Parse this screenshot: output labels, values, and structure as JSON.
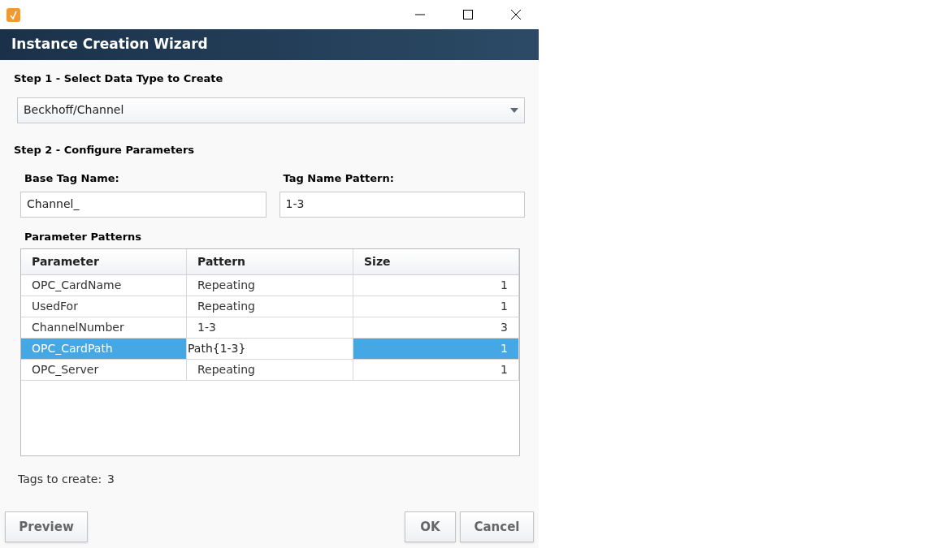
{
  "header": {
    "title": "Instance Creation Wizard"
  },
  "step1": {
    "label": "Step 1 - Select Data Type to Create",
    "dropdown": {
      "value": "Beckhoff/Channel"
    }
  },
  "step2": {
    "label": "Step 2 - Configure Parameters",
    "base_tag_name": {
      "label": "Base Tag Name:",
      "value": "Channel_"
    },
    "tag_name_pattern": {
      "label": "Tag Name Pattern:",
      "value": "1-3"
    }
  },
  "table": {
    "title": "Parameter Patterns",
    "columns": [
      "Parameter",
      "Pattern",
      "Size"
    ],
    "rows": [
      {
        "cells": [
          "OPC_CardName",
          "Repeating",
          "1"
        ],
        "selected": false,
        "editing": false
      },
      {
        "cells": [
          "UsedFor",
          "Repeating",
          "1"
        ],
        "selected": false,
        "editing": false
      },
      {
        "cells": [
          "ChannelNumber",
          "1-3",
          "3"
        ],
        "selected": false,
        "editing": false
      },
      {
        "cells": [
          "OPC_CardPath",
          "Path{1-3}",
          "1"
        ],
        "selected": true,
        "editing": true
      },
      {
        "cells": [
          "OPC_Server",
          "Repeating",
          "1"
        ],
        "selected": false,
        "editing": false
      }
    ]
  },
  "summary": {
    "label": "Tags to create:",
    "value": "3"
  },
  "buttons": {
    "left": [
      "Preview"
    ],
    "right": [
      "OK",
      "Cancel"
    ]
  }
}
